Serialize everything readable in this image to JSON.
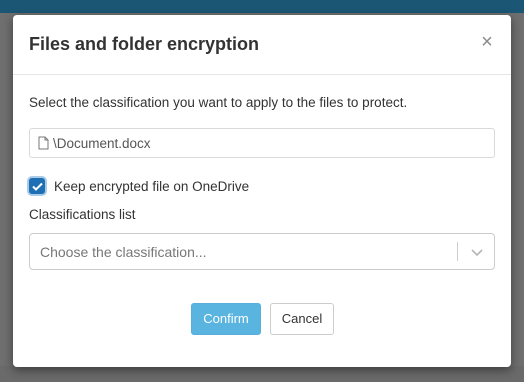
{
  "dialog": {
    "title": "Files and folder encryption",
    "close_glyph": "×",
    "instruction": "Select the classification you want to apply to the files to protect.",
    "file": {
      "icon": "file-icon",
      "name": "\\Document.docx"
    },
    "keep_encrypted": {
      "checked": true,
      "label": "Keep encrypted file on OneDrive"
    },
    "classifications": {
      "label": "Classifications list",
      "placeholder": "Choose the classification...",
      "icon": "chevron-down-icon"
    },
    "buttons": {
      "confirm": "Confirm",
      "cancel": "Cancel"
    }
  },
  "colors": {
    "topbar": "#1b5775",
    "backdrop": "#6f6f6f",
    "confirm_button": "#5ab4e0",
    "checkbox": "#1f6fb5"
  }
}
